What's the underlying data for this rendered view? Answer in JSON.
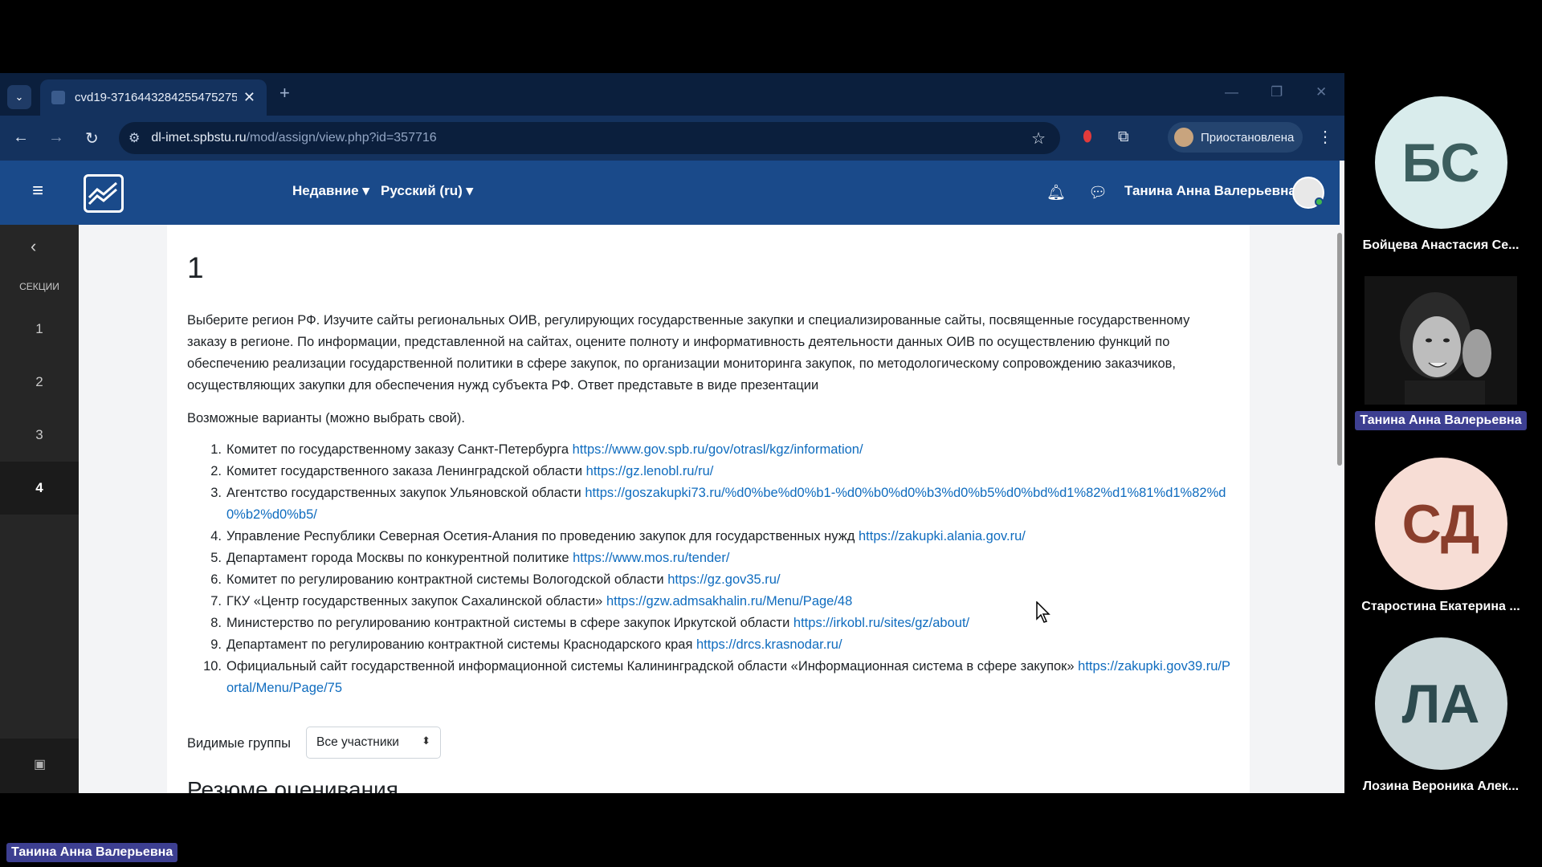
{
  "browser": {
    "tab_title": "cvd19-3716443284255475275",
    "url_host": "dl-imet.spbstu.ru",
    "url_path": "/mod/assign/view.php?id=357716",
    "profile_label": "Приостановлена"
  },
  "site_nav": {
    "recent_label": "Недавние ▾",
    "language_label": "Русский (ru) ▾",
    "user_name": "Танина Анна Валерьевна"
  },
  "course_index": {
    "heading": "СЕКЦИИ",
    "items": [
      "1",
      "2",
      "3",
      "4"
    ],
    "active_item": "4"
  },
  "main": {
    "title": "1",
    "description": "Выберите регион РФ. Изучите сайты региональных ОИВ, регулирующих государственные закупки и специализированные сайты, посвященные государственному заказу в регионе. По информации, представленной на сайтах, оцените полноту и информативность деятельности данных ОИВ по осуществлению функций по обеспечению реализации государственной политики в сфере закупок, по организации мониторинга закупок, по методологическому сопровождению заказчиков, осуществляющих закупки для обеспечения нужд субъекта РФ. Ответ представьте в виде презентации",
    "variants_label": "Возможные варианты (можно выбрать свой).",
    "options": [
      {
        "num": "1.",
        "text": "Комитет по государственному заказу Санкт-Петербурга ",
        "link": "https://www.gov.spb.ru/gov/otrasl/kgz/information/"
      },
      {
        "num": "2.",
        "text": "Комитет государственного заказа Ленинградской области ",
        "link": "https://gz.lenobl.ru/ru/"
      },
      {
        "num": "3.",
        "text": "Агентство государственных закупок Ульяновской области ",
        "link": "https://goszakupki73.ru/%d0%be%d0%b1-%d0%b0%d0%b3%d0%b5%d0%bd%d1%82%d1%81%d1%82%d0%b2%d0%b5/"
      },
      {
        "num": "4.",
        "text": "Управление Республики Северная Осетия-Алания по проведению закупок для государственных нужд ",
        "link": "https://zakupki.alania.gov.ru/"
      },
      {
        "num": "5.",
        "text": "Департамент города Москвы по конкурентной политике ",
        "link": "https://www.mos.ru/tender/"
      },
      {
        "num": "6.",
        "text": "Комитет по регулированию контрактной системы Вологодской области ",
        "link": "https://gz.gov35.ru/"
      },
      {
        "num": "7.",
        "text": "ГКУ «Центр государственных закупок Сахалинской области» ",
        "link": "https://gzw.admsakhalin.ru/Menu/Page/48"
      },
      {
        "num": "8.",
        "text": "Министерство по регулированию контрактной системы в сфере закупок Иркутской области ",
        "link": "https://irkobl.ru/sites/gz/about/"
      },
      {
        "num": "9.",
        "text": "Департамент по регулированию контрактной системы Краснодарского края ",
        "link": "https://drcs.krasnodar.ru/"
      },
      {
        "num": "10.",
        "text": "Официальный сайт государственной информационной системы Калининградской области «Информационная система в сфере закупок» ",
        "link": "https://zakupki.gov39.ru/Portal/Menu/Page/75"
      }
    ],
    "groups_label": "Видимые группы",
    "groups_value": "Все участники",
    "summary_heading": "Резюме оценивания"
  },
  "call": {
    "participants": [
      {
        "initials": "БС",
        "name": "Бойцева Анастасия Се...",
        "bg": "#d9ecec",
        "fg": "#3c5e5e"
      },
      {
        "initials": "",
        "name": "Танина Анна Валерьевна",
        "video": true
      },
      {
        "initials": "СД",
        "name": "Старостина Екатерина ...",
        "bg": "#f7ddd5",
        "fg": "#8a3e2c"
      },
      {
        "initials": "ЛА",
        "name": "Лозина Вероника Алек...",
        "bg": "#c9d6d8",
        "fg": "#2d4a4e"
      }
    ],
    "speaker_name": "Танина Анна Валерьевна"
  },
  "colors": {
    "nav_blue": "#1a4a8a",
    "link_blue": "#0f6cbf",
    "call_highlight": "#3d3f91"
  }
}
